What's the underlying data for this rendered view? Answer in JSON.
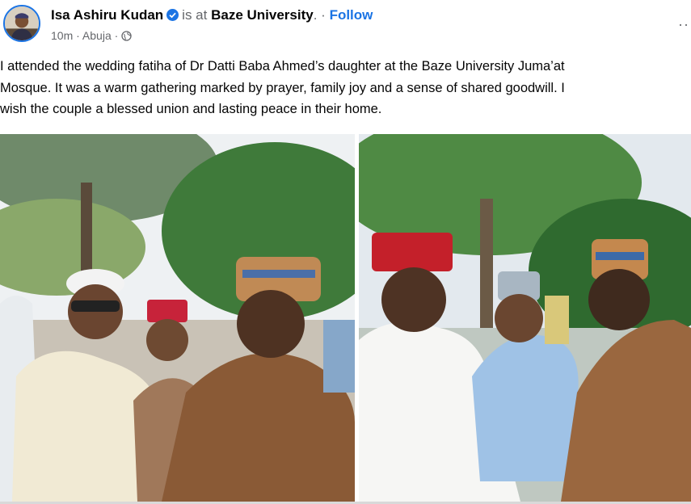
{
  "post": {
    "author": "Isa Ashiru Kudan",
    "verified_icon": "verified-badge-icon",
    "is_at": "is at",
    "place": "Baze University",
    "separator": ". ·",
    "follow": "Follow",
    "time": "10m",
    "location": "Abuja",
    "meta_sep": "·",
    "privacy_icon": "globe-icon",
    "more_icon": "more-dots-icon",
    "more_glyph": "··",
    "text": "I attended the wedding fatiha of Dr Datti Baba Ahmed’s daughter at the Baze University Juma’at\nMosque. It was a warm gathering marked by prayer, family joy and a sense of shared goodwill. I\nwish the couple a blessed union and lasting peace in their home."
  },
  "colors": {
    "link": "#1b74e4",
    "secondary_text": "#65676b",
    "primary_text": "#050505"
  }
}
